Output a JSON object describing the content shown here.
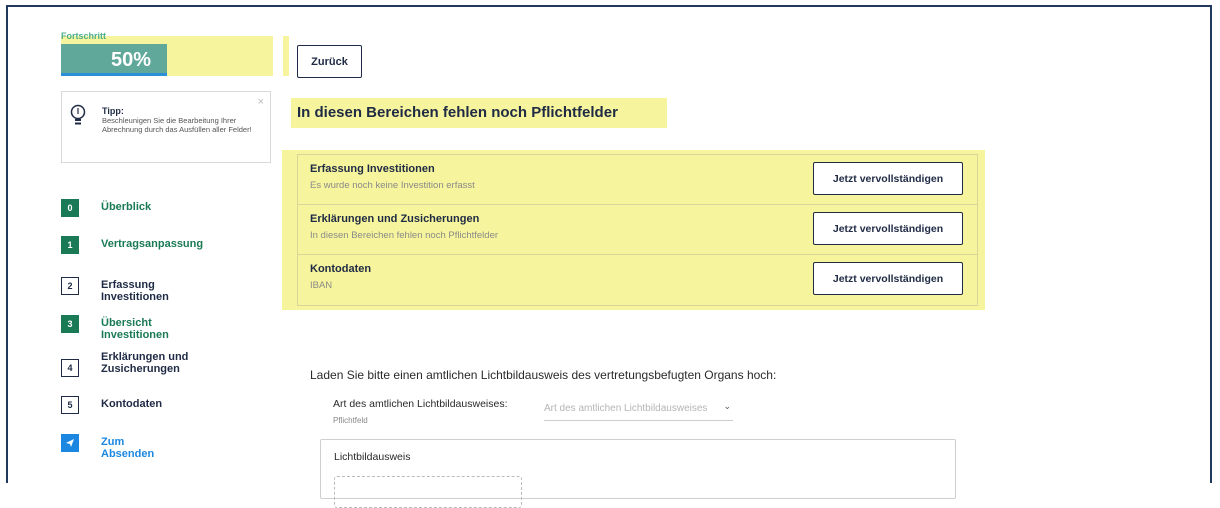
{
  "progress": {
    "caption": "Fortschritt",
    "percent_text": "50%",
    "value": 0.5
  },
  "tip": {
    "title": "Tipp:",
    "text": "Beschleunigen Sie die Bearbeitung Ihrer Abrechnung durch das Ausfüllen aller Felder!",
    "close": "×"
  },
  "steps": [
    {
      "number": "0",
      "label": "Überblick"
    },
    {
      "number": "1",
      "label": "Vertragsanpassung"
    },
    {
      "number": "2",
      "label": "Erfassung Investitionen"
    },
    {
      "number": "3",
      "label": "Übersicht Investitionen"
    },
    {
      "number": "4",
      "label": "Erklärungen und Zusicherungen"
    },
    {
      "number": "5",
      "label": "Kontodaten"
    },
    {
      "number": "",
      "label": "Zum Absenden"
    }
  ],
  "back_button": "Zurück",
  "heading": "In diesen Bereichen fehlen noch Pflichtfelder",
  "missing": [
    {
      "title": "Erfassung Investitionen",
      "subtitle": "Es wurde noch keine Investition erfasst",
      "button": "Jetzt vervollständigen"
    },
    {
      "title": "Erklärungen und Zusicherungen",
      "subtitle": "In diesen Bereichen fehlen noch Pflichtfelder",
      "button": "Jetzt vervollständigen"
    },
    {
      "title": "Kontodaten",
      "subtitle": "IBAN",
      "button": "Jetzt vervollständigen"
    }
  ],
  "upload": {
    "intro": "Laden Sie bitte einen amtlichen Lichtbildausweis des vertretungsbefugten Organs hoch:",
    "field_label": "Art des amtlichen Lichtbildausweises:",
    "field_required": "Pflichtfeld",
    "select_placeholder": "Art des amtlichen Lichtbildausweises",
    "card_title": "Lichtbildausweis"
  },
  "colors": {
    "highlight": "#f6f49c",
    "green": "#1a7a55",
    "blue": "#1b87e0",
    "navy": "#1f2a44"
  }
}
